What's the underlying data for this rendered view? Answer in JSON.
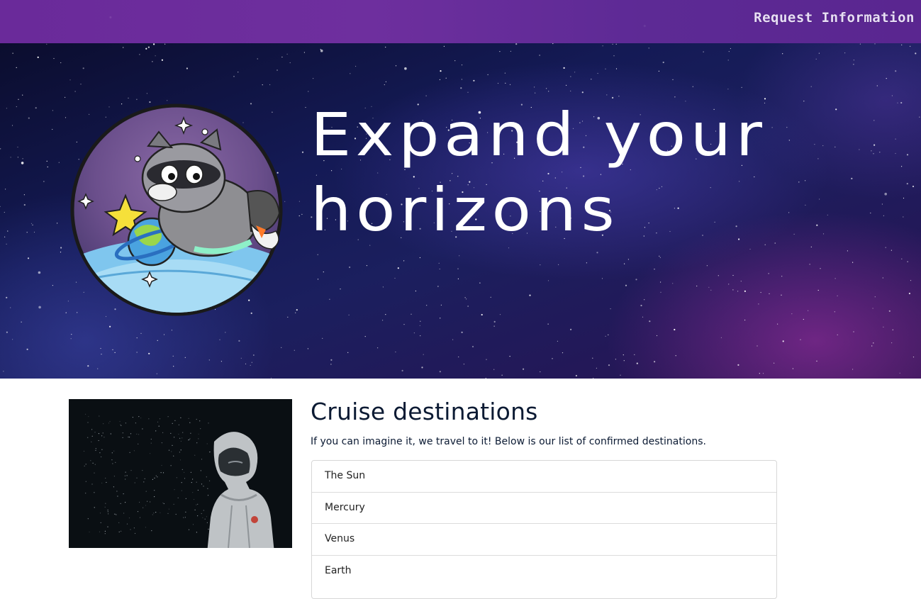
{
  "nav": {
    "request_info_label": "Request Information"
  },
  "hero": {
    "title": "Expand your horizons",
    "mascot_icon": "raccoon-astronaut-logo"
  },
  "destinations": {
    "title": "Cruise destinations",
    "description": "If you can imagine it, we travel to it! Below is our list of confirmed destinations.",
    "items": [
      {
        "label": "The Sun"
      },
      {
        "label": "Mercury"
      },
      {
        "label": "Venus"
      },
      {
        "label": "Earth"
      }
    ]
  },
  "colors": {
    "nav_bg": "#6a2a9a",
    "hero_bg": "#141a55",
    "text_dark": "#0b1a33"
  }
}
